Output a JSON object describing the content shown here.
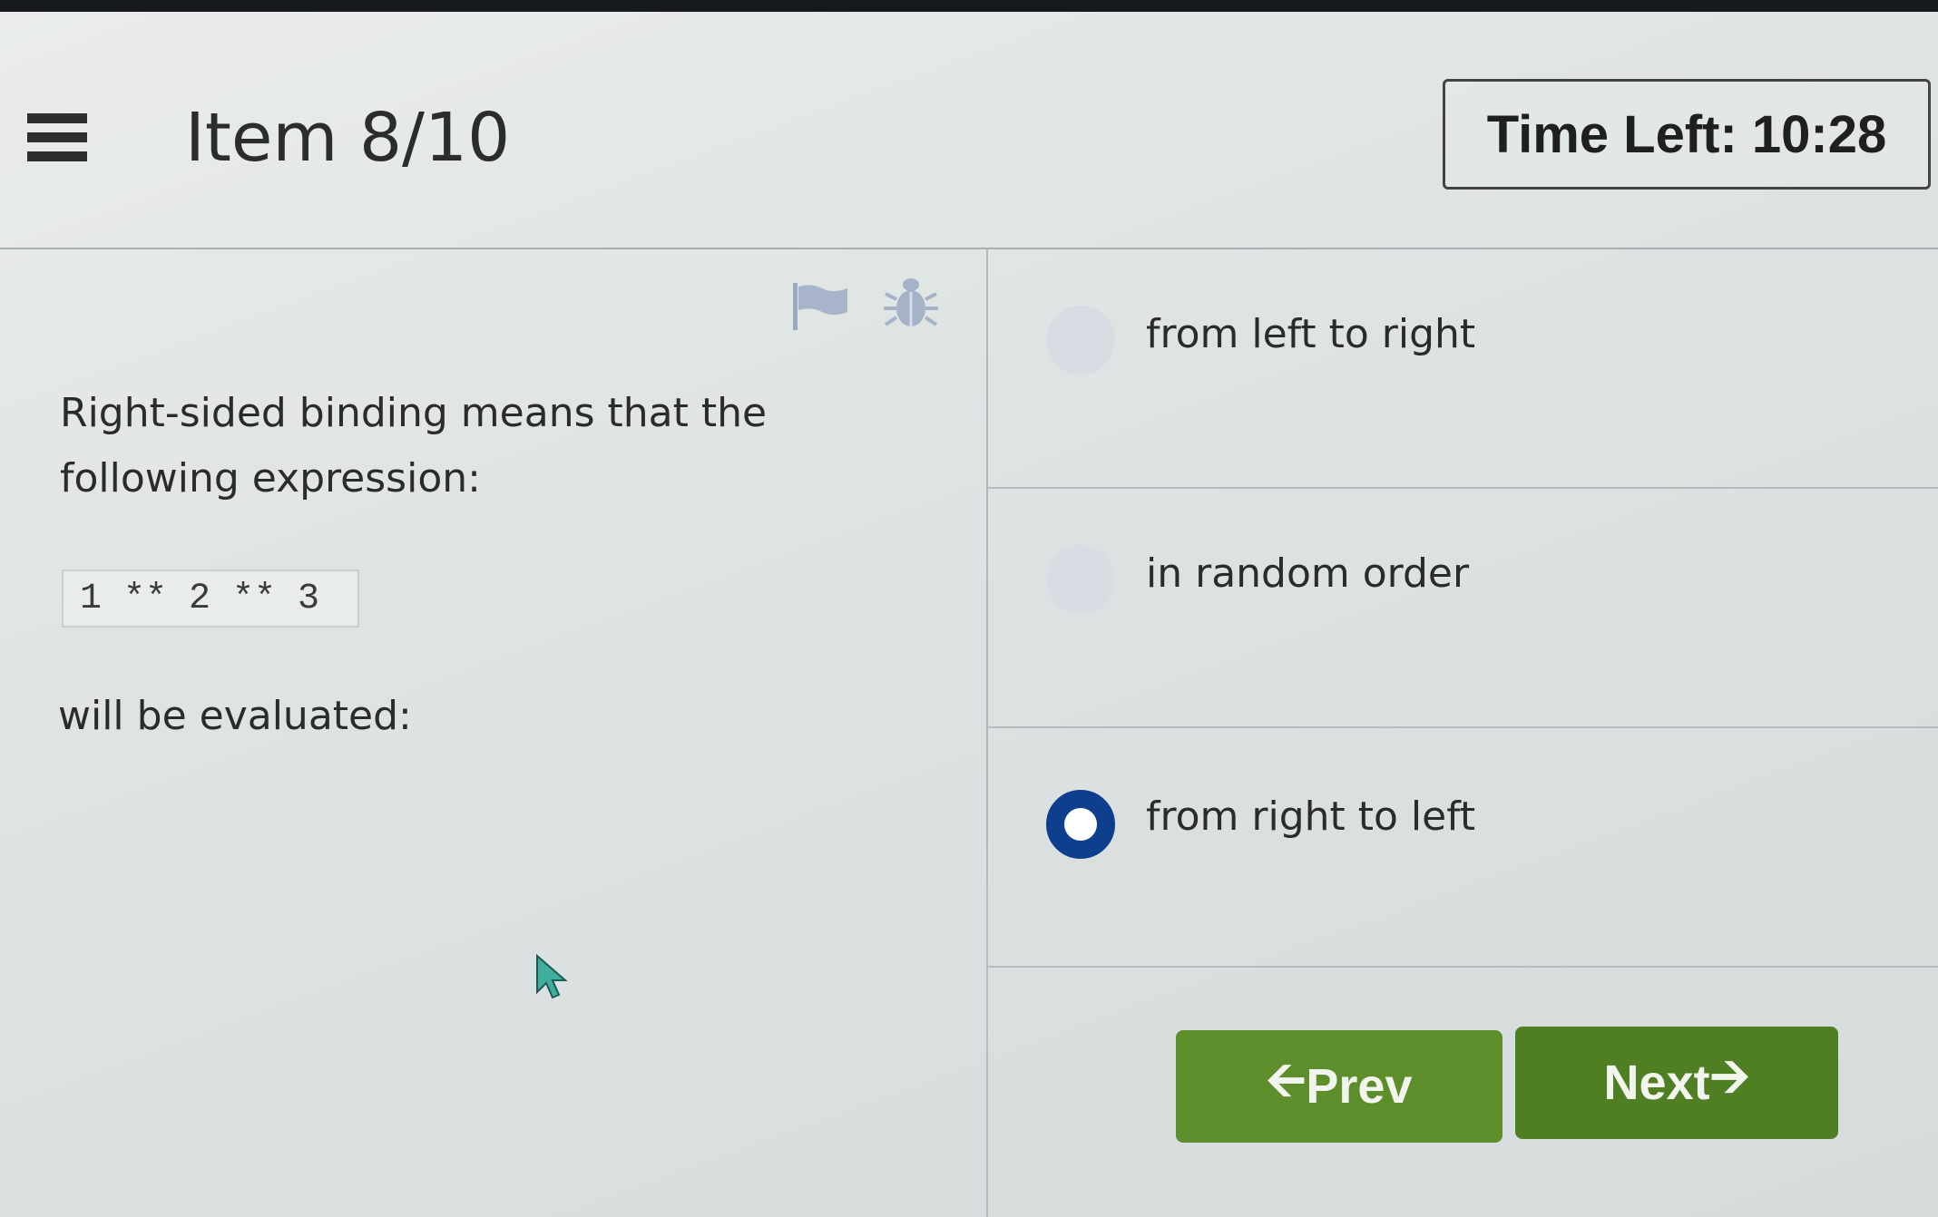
{
  "header": {
    "menu_icon": "hamburger-icon",
    "item_title": "Item 8/10",
    "timer": "Time Left: 10:28"
  },
  "toolbar": {
    "flag_icon": "flag-icon",
    "bug_icon": "bug-icon"
  },
  "question": {
    "text": "Right-sided binding means that the following expression:",
    "code": "1 ** 2 ** 3",
    "tail": "will be evaluated:"
  },
  "options": [
    {
      "label": "from left to right",
      "selected": false
    },
    {
      "label": "in random order",
      "selected": false
    },
    {
      "label": "from right to left",
      "selected": true
    }
  ],
  "nav": {
    "prev_label": "Prev",
    "prev_icon": "arrow-left-icon",
    "next_label": "Next",
    "next_icon": "arrow-right-icon"
  },
  "colors": {
    "selected_radio": "#0e3f8e",
    "button_green": "#5e8d2b",
    "unselected_radio": "#d9dce3"
  }
}
